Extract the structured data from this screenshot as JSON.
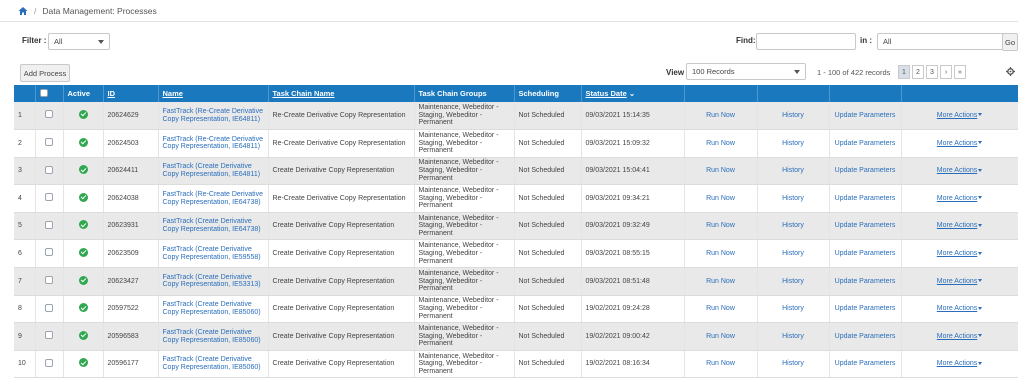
{
  "breadcrumb": {
    "sep": "/",
    "label": "Data Management: Processes"
  },
  "filter": {
    "label": "Filter :",
    "value": "All"
  },
  "find": {
    "label": "Find:",
    "value": "",
    "in_label": "in :",
    "in_value": "All",
    "go": "Go"
  },
  "toolbar": {
    "add_process": "Add Process",
    "view_label": "View",
    "view_value": "100 Records",
    "range": "1 - 100 of 422 records",
    "pages": [
      "1",
      "2",
      "3"
    ],
    "next": "›",
    "last": "»",
    "active_page": "1"
  },
  "table": {
    "headers": {
      "active": "Active",
      "id": "ID",
      "name": "Name",
      "task_chain_name": "Task Chain Name",
      "task_chain_groups": "Task Chain Groups",
      "scheduling": "Scheduling",
      "status_date": "Status Date",
      "sort_arrow": "⌄"
    },
    "rows": [
      {
        "num": "1",
        "id": "20624629",
        "name": "FastTrack (Re-Create Derivative Copy Representation, IE64811)",
        "chain": "Re-Create Derivative Copy Representation",
        "groups": "Maintenance, Webeditor - Staging, Webeditor - Permanent",
        "scheduling": "Not Scheduled",
        "date": "09/03/2021 15:14:35"
      },
      {
        "num": "2",
        "id": "20624503",
        "name": "FastTrack (Re-Create Derivative Copy Representation, IE64811)",
        "chain": "Re-Create Derivative Copy Representation",
        "groups": "Maintenance, Webeditor - Staging, Webeditor - Permanent",
        "scheduling": "Not Scheduled",
        "date": "09/03/2021 15:09:32"
      },
      {
        "num": "3",
        "id": "20624411",
        "name": "FastTrack (Create Derivative Copy Representation, IE64811)",
        "chain": "Create Derivative Copy Representation",
        "groups": "Maintenance, Webeditor - Staging, Webeditor - Permanent",
        "scheduling": "Not Scheduled",
        "date": "09/03/2021 15:04:41"
      },
      {
        "num": "4",
        "id": "20624038",
        "name": "FastTrack (Re-Create Derivative Copy Representation, IE64738)",
        "chain": "Re-Create Derivative Copy Representation",
        "groups": "Maintenance, Webeditor - Staging, Webeditor - Permanent",
        "scheduling": "Not Scheduled",
        "date": "09/03/2021 09:34:21"
      },
      {
        "num": "5",
        "id": "20623931",
        "name": "FastTrack (Create Derivative Copy Representation, IE64738)",
        "chain": "Create Derivative Copy Representation",
        "groups": "Maintenance, Webeditor - Staging, Webeditor - Permanent",
        "scheduling": "Not Scheduled",
        "date": "09/03/2021 09:32:49"
      },
      {
        "num": "6",
        "id": "20623509",
        "name": "FastTrack (Create Derivative Copy Representation, IE59558)",
        "chain": "Create Derivative Copy Representation",
        "groups": "Maintenance, Webeditor - Staging, Webeditor - Permanent",
        "scheduling": "Not Scheduled",
        "date": "09/03/2021 08:55:15"
      },
      {
        "num": "7",
        "id": "20623427",
        "name": "FastTrack (Create Derivative Copy Representation, IE53313)",
        "chain": "Create Derivative Copy Representation",
        "groups": "Maintenance, Webeditor - Staging, Webeditor - Permanent",
        "scheduling": "Not Scheduled",
        "date": "09/03/2021 08:51:48"
      },
      {
        "num": "8",
        "id": "20597522",
        "name": "FastTrack (Create Derivative Copy Representation, IE85060)",
        "chain": "Create Derivative Copy Representation",
        "groups": "Maintenance, Webeditor - Staging, Webeditor - Permanent",
        "scheduling": "Not Scheduled",
        "date": "19/02/2021 09:24:28"
      },
      {
        "num": "9",
        "id": "20596583",
        "name": "FastTrack (Create Derivative Copy Representation, IE85060)",
        "chain": "Create Derivative Copy Representation",
        "groups": "Maintenance, Webeditor - Staging, Webeditor - Permanent",
        "scheduling": "Not Scheduled",
        "date": "19/02/2021 09:00:42"
      },
      {
        "num": "10",
        "id": "20596177",
        "name": "FastTrack (Create Derivative Copy Representation, IE85060)",
        "chain": "Create Derivative Copy Representation",
        "groups": "Maintenance, Webeditor - Staging, Webeditor - Permanent",
        "scheduling": "Not Scheduled",
        "date": "19/02/2021 08:16:34"
      }
    ],
    "actions": {
      "run_now": "Run Now",
      "history": "History",
      "update_parameters": "Update Parameters",
      "more_actions": "More Actions"
    }
  },
  "colors": {
    "header_bg": "#1a78bf",
    "link": "#2a6ebb",
    "active_check": "#2fa84f"
  }
}
